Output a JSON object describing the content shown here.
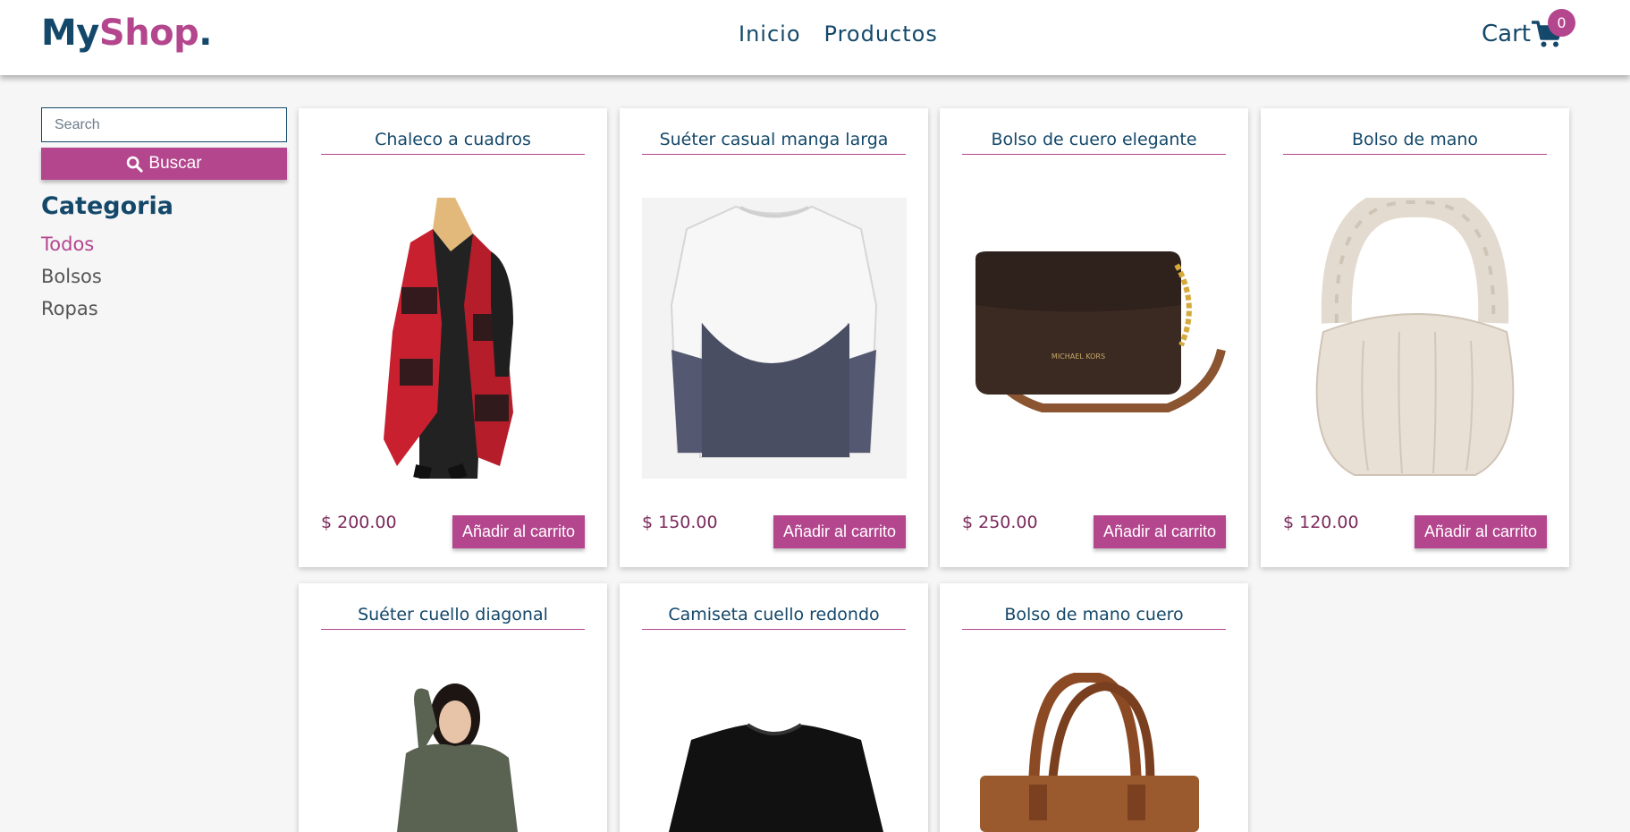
{
  "header": {
    "logo": {
      "part1": "My",
      "part2": "Shop",
      "part3": "."
    },
    "nav": [
      "Inicio",
      "Productos"
    ],
    "cart_label": "Cart",
    "cart_count": "0",
    "cart_icon": "shopping-cart-icon"
  },
  "sidebar": {
    "search_placeholder": "Search",
    "search_button": "Buscar",
    "search_icon": "search-icon",
    "category_title": "Categoria",
    "categories": [
      "Todos",
      "Bolsos",
      "Ropas"
    ],
    "active_category": "Todos"
  },
  "colors": {
    "primary": "#14486a",
    "accent": "#b4468e"
  },
  "products": [
    {
      "title": "Chaleco a cuadros",
      "price": "$ 200.00",
      "button": "Añadir al carrito"
    },
    {
      "title": "Suéter casual manga larga",
      "price": "$ 150.00",
      "button": "Añadir al carrito"
    },
    {
      "title": "Bolso de cuero elegante",
      "price": "$ 250.00",
      "button": "Añadir al carrito"
    },
    {
      "title": "Bolso de mano",
      "price": "$ 120.00",
      "button": "Añadir al carrito"
    },
    {
      "title": "Suéter cuello diagonal"
    },
    {
      "title": "Camiseta cuello redondo"
    },
    {
      "title": "Bolso de mano cuero"
    }
  ]
}
